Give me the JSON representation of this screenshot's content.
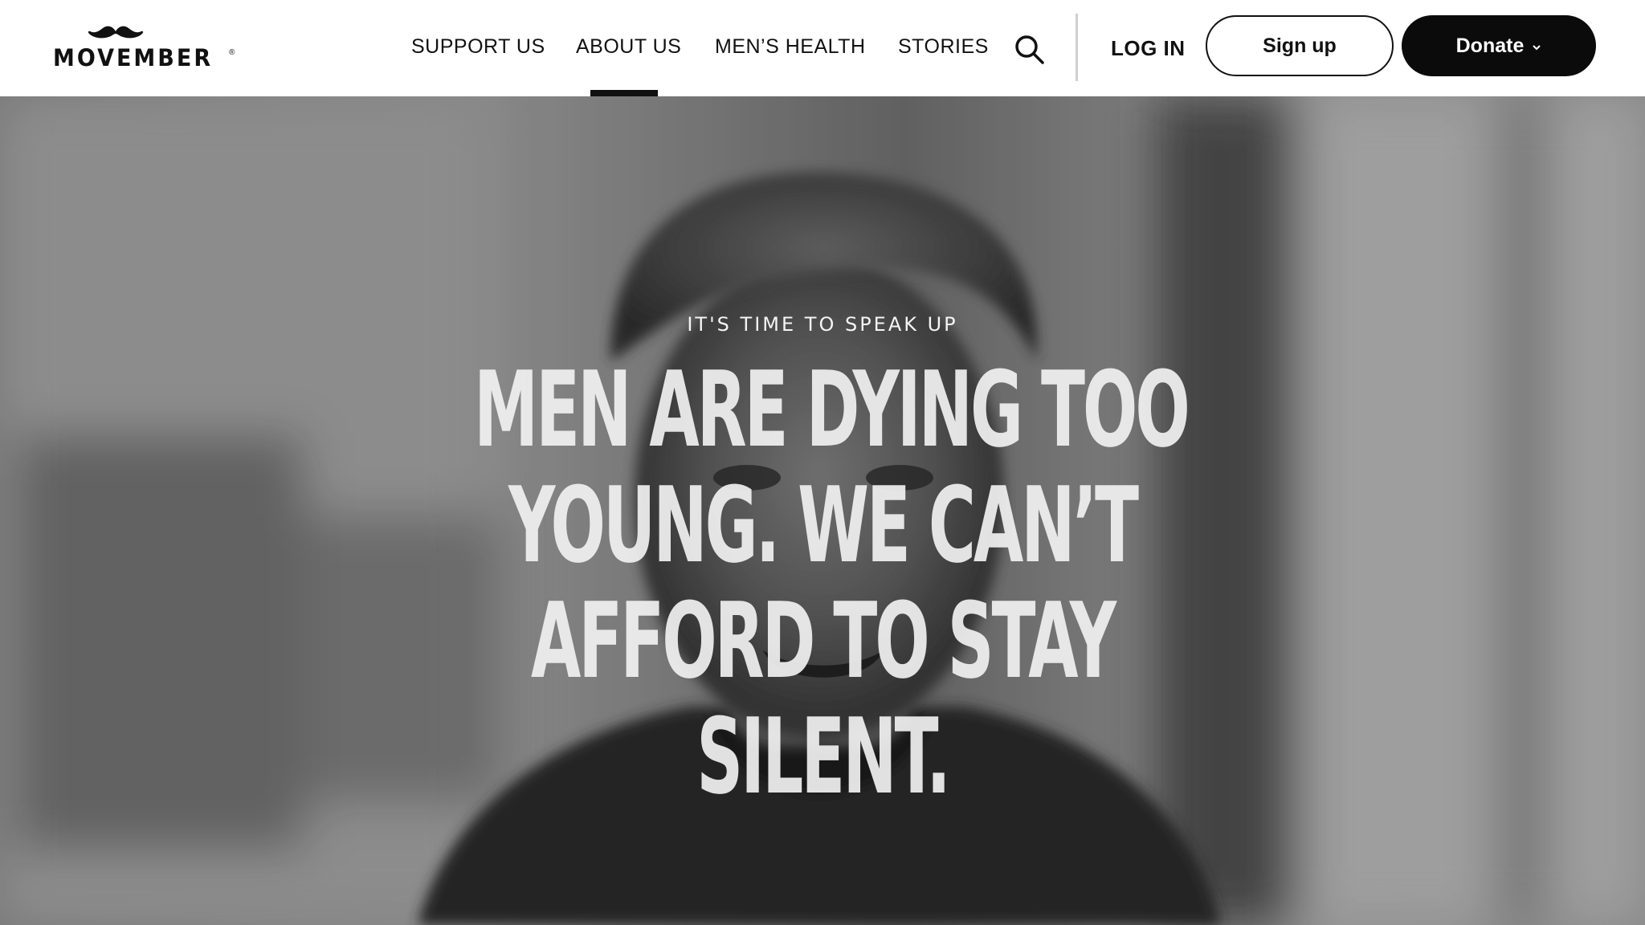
{
  "brand": {
    "logo_text": "MOVEMBER",
    "registered_mark": "®"
  },
  "nav": {
    "items": [
      {
        "label": "SUPPORT US",
        "active": false
      },
      {
        "label": "ABOUT US",
        "active": true
      },
      {
        "label": "MEN’S HEALTH",
        "active": false
      },
      {
        "label": "STORIES",
        "active": false
      }
    ],
    "search_icon": "search-icon",
    "login_label": "LOG IN",
    "signup_label": "Sign up",
    "donate_label": "Donate",
    "donate_icon": "chevron-down-icon"
  },
  "hero": {
    "eyebrow": "IT'S TIME TO SPEAK UP",
    "headline_lines": [
      "MEN ARE DYING TOO",
      "YOUNG. WE CAN’T",
      "AFFORD TO STAY",
      "SILENT."
    ]
  },
  "colors": {
    "text": "#111111",
    "donate_bg": "#0b0b0b",
    "divider": "#cfcfcf",
    "hero_text": "#f0f0f0"
  }
}
